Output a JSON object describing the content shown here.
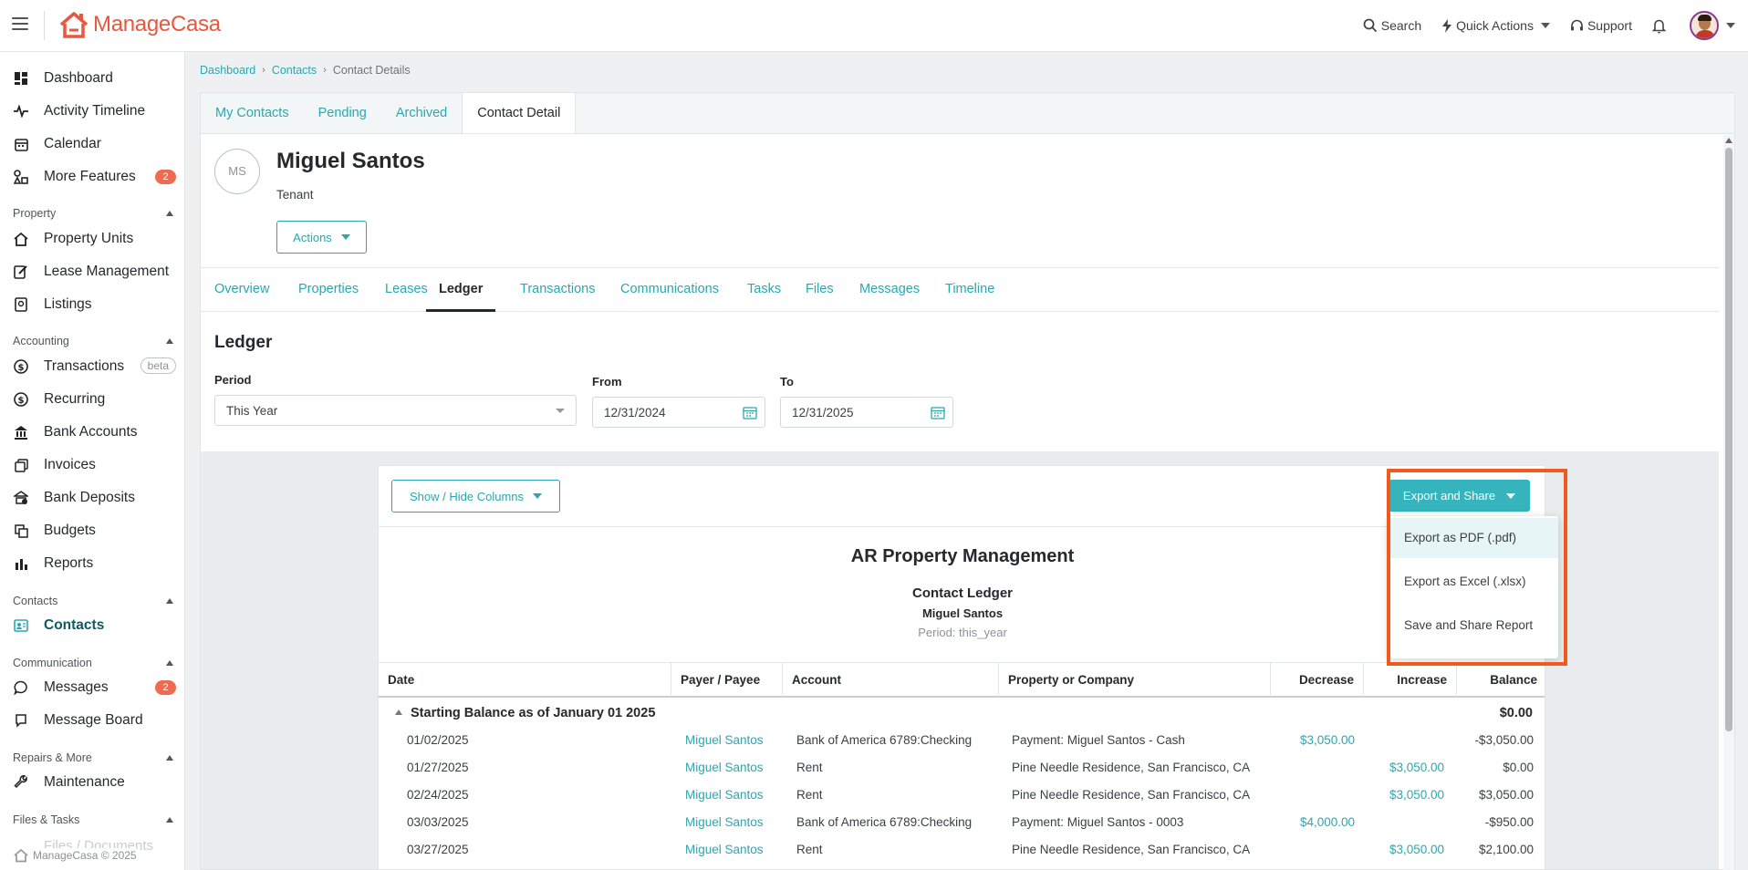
{
  "app": {
    "name_part1": "Manage",
    "name_part2": "Casa"
  },
  "topnav": {
    "search": "Search",
    "quick_actions": "Quick Actions",
    "support": "Support"
  },
  "sidebar": {
    "items_top": [
      {
        "label": "Dashboard"
      },
      {
        "label": "Activity Timeline"
      },
      {
        "label": "Calendar"
      },
      {
        "label": "More Features",
        "badge": "2"
      }
    ],
    "group_property": "Property",
    "items_property": [
      {
        "label": "Property Units"
      },
      {
        "label": "Lease Management"
      },
      {
        "label": "Listings"
      }
    ],
    "group_accounting": "Accounting",
    "items_accounting": [
      {
        "label": "Transactions",
        "tag": "beta"
      },
      {
        "label": "Recurring"
      },
      {
        "label": "Bank Accounts"
      },
      {
        "label": "Invoices"
      },
      {
        "label": "Bank Deposits"
      },
      {
        "label": "Budgets"
      },
      {
        "label": "Reports"
      }
    ],
    "group_contacts": "Contacts",
    "items_contacts": [
      {
        "label": "Contacts"
      }
    ],
    "group_communication": "Communication",
    "items_communication": [
      {
        "label": "Messages",
        "badge": "2"
      },
      {
        "label": "Message Board"
      }
    ],
    "group_repairs": "Repairs & More",
    "items_repairs": [
      {
        "label": "Maintenance"
      }
    ],
    "group_files": "Files & Tasks",
    "ghost_item": "Files / Documents",
    "footer": {
      "part1": "Manage",
      "part2": "Casa",
      "copyright": "© 2025"
    }
  },
  "breadcrumb": [
    "Dashboard",
    "Contacts",
    "Contact Details"
  ],
  "top_tabs": [
    "My Contacts",
    "Pending",
    "Archived",
    "Contact Detail"
  ],
  "contact": {
    "initials": "MS",
    "name": "Miguel Santos",
    "role": "Tenant",
    "actions_label": "Actions"
  },
  "sub_tabs": [
    "Overview",
    "Properties",
    "Leases",
    "Ledger",
    "Transactions",
    "Communications",
    "Tasks",
    "Files",
    "Messages",
    "Timeline"
  ],
  "ledger": {
    "title": "Ledger",
    "period_label": "Period",
    "period_value": "This Year",
    "from_label": "From",
    "from_value": "12/31/2024",
    "to_label": "To",
    "to_value": "12/31/2025"
  },
  "report": {
    "show_hide_label": "Show / Hide Columns",
    "export_label": "Export and Share",
    "export_options": [
      "Export as PDF (.pdf)",
      "Export as Excel (.xlsx)",
      "Save and Share Report"
    ],
    "company": "AR Property Management",
    "title": "Contact Ledger",
    "contact": "Miguel Santos",
    "period": "Period: this_year",
    "columns": [
      "Date",
      "Payer / Payee",
      "Account",
      "Property or Company",
      "Decrease",
      "Increase",
      "Balance"
    ],
    "starting_balance_label": "Starting Balance as of January 01 2025",
    "starting_balance_value": "$0.00",
    "rows": [
      {
        "date": "01/02/2025",
        "payee": "Miguel Santos",
        "account": "Bank of America 6789:Checking",
        "property": "Payment: Miguel Santos - Cash",
        "decrease": "$3,050.00",
        "increase": "",
        "balance": "-$3,050.00"
      },
      {
        "date": "01/27/2025",
        "payee": "Miguel Santos",
        "account": "Rent",
        "property": "Pine Needle Residence, San Francisco, CA",
        "decrease": "",
        "increase": "$3,050.00",
        "balance": "$0.00"
      },
      {
        "date": "02/24/2025",
        "payee": "Miguel Santos",
        "account": "Rent",
        "property": "Pine Needle Residence, San Francisco, CA",
        "decrease": "",
        "increase": "$3,050.00",
        "balance": "$3,050.00"
      },
      {
        "date": "03/03/2025",
        "payee": "Miguel Santos",
        "account": "Bank of America 6789:Checking",
        "property": "Payment: Miguel Santos - 0003",
        "decrease": "$4,000.00",
        "increase": "",
        "balance": "-$950.00"
      },
      {
        "date": "03/27/2025",
        "payee": "Miguel Santos",
        "account": "Rent",
        "property": "Pine Needle Residence, San Francisco, CA",
        "decrease": "",
        "increase": "$3,050.00",
        "balance": "$2,100.00"
      }
    ]
  },
  "colors": {
    "brand": "#e8573f",
    "accent": "#2ba7b0",
    "badge": "#ef6a4f",
    "highlight": "#f25a1d"
  }
}
